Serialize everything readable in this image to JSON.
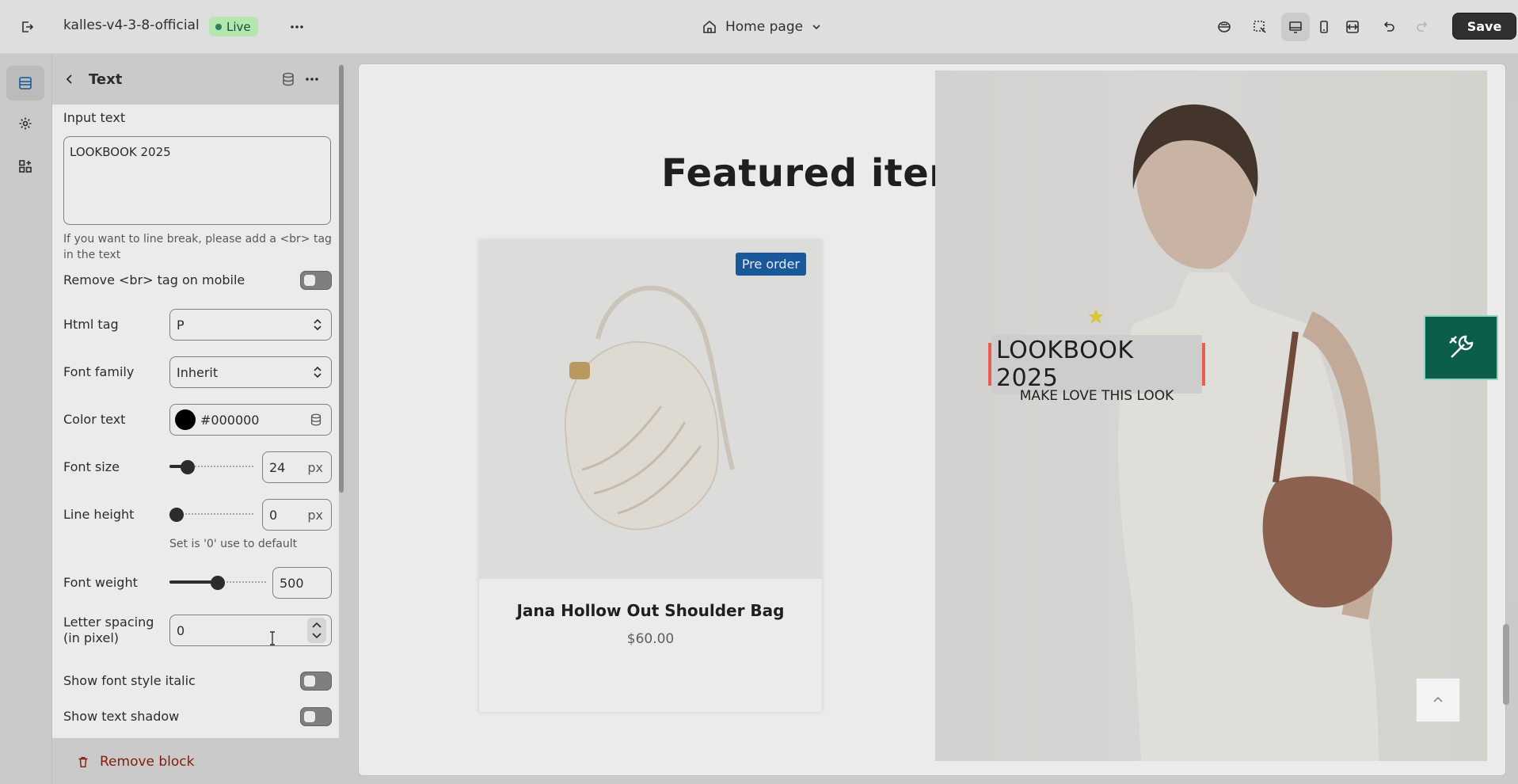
{
  "topbar": {
    "store_name": "kalles-v4-3-8-official",
    "live_label": "Live",
    "page_name": "Home page",
    "save_label": "Save"
  },
  "panel": {
    "title": "Text",
    "input_text_label": "Input text",
    "input_text_value": "LOOKBOOK 2025",
    "line_break_help": "If you want to line break, please add a <br> tag in the text",
    "remove_br_label": "Remove <br> tag on mobile",
    "html_tag_label": "Html tag",
    "html_tag_value": "P",
    "font_family_label": "Font family",
    "font_family_value": "Inherit",
    "color_text_label": "Color text",
    "color_text_value": "#000000",
    "font_size_label": "Font size",
    "font_size_value": "24",
    "font_size_unit": "px",
    "line_height_label": "Line height",
    "line_height_value": "0",
    "line_height_unit": "px",
    "line_height_help": "Set is '0' use to default",
    "font_weight_label": "Font weight",
    "font_weight_value": "500",
    "letter_spacing_label": "Letter spacing (in pixel)",
    "letter_spacing_value": "0",
    "italic_label": "Show font style italic",
    "shadow_label": "Show text shadow",
    "remove_block_label": "Remove block"
  },
  "preview": {
    "featured_title": "Featured items",
    "preorder_badge": "Pre order",
    "product_name": "Jana Hollow Out Shoulder Bag",
    "product_price": "$60.00",
    "lookbook_heading": "LOOKBOOK 2025",
    "lookbook_sub": "MAKE LOVE THIS LOOK"
  },
  "colors": {
    "accent": "#303030",
    "live_badge": "#b4e6ad",
    "preorder": "#1c60a9",
    "selection_outline": "#ea5b51",
    "tools_button": "#0b5e4c"
  },
  "icons": {
    "exit": "exit-icon",
    "more": "more-horizontal-icon",
    "home": "home-icon",
    "chevron": "chevron-down-icon",
    "sections": "sections-icon",
    "settings": "gear-icon",
    "apps": "apps-icon",
    "back": "chevron-left-icon",
    "database": "database-icon",
    "desktop": "desktop-icon",
    "mobile": "mobile-icon",
    "fullwidth": "fullwidth-icon",
    "undo": "undo-icon",
    "redo": "redo-icon",
    "trash": "trash-icon",
    "tools": "tools-icon",
    "star": "star-icon"
  }
}
